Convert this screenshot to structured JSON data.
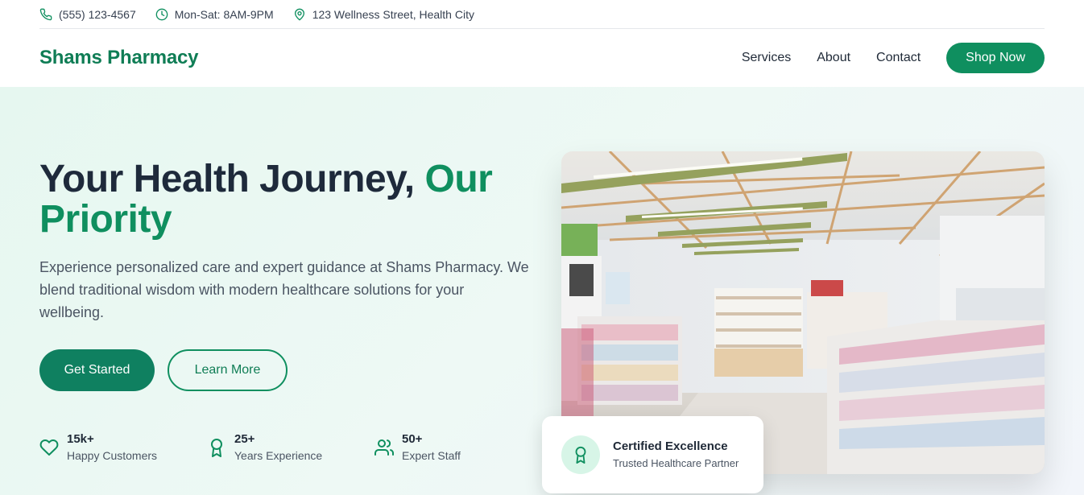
{
  "topbar": {
    "phone": "(555) 123-4567",
    "hours": "Mon-Sat: 8AM-9PM",
    "address": "123 Wellness Street, Health City"
  },
  "nav": {
    "brand": "Shams Pharmacy",
    "links": [
      "Services",
      "About",
      "Contact"
    ],
    "cta": "Shop Now"
  },
  "hero": {
    "headline_main": "Your Health Journey, ",
    "headline_accent": "Our Priority",
    "lead": "Experience personalized care and expert guidance at Shams Pharmacy. We blend traditional wisdom with modern healthcare solutions for your wellbeing.",
    "primary_button": "Get Started",
    "secondary_button": "Learn More",
    "stats": [
      {
        "value": "15k+",
        "label": "Happy Customers",
        "icon": "heart-icon"
      },
      {
        "value": "25+",
        "label": "Years Experience",
        "icon": "award-icon"
      },
      {
        "value": "50+",
        "label": "Expert Staff",
        "icon": "users-icon"
      }
    ]
  },
  "badge": {
    "title": "Certified Excellence",
    "subtitle": "Trusted Healthcare Partner",
    "icon": "award-icon"
  },
  "colors": {
    "brand": "#0f8f5f",
    "heading": "#1e2a3b",
    "hero_bg": "#e6f7f0"
  }
}
